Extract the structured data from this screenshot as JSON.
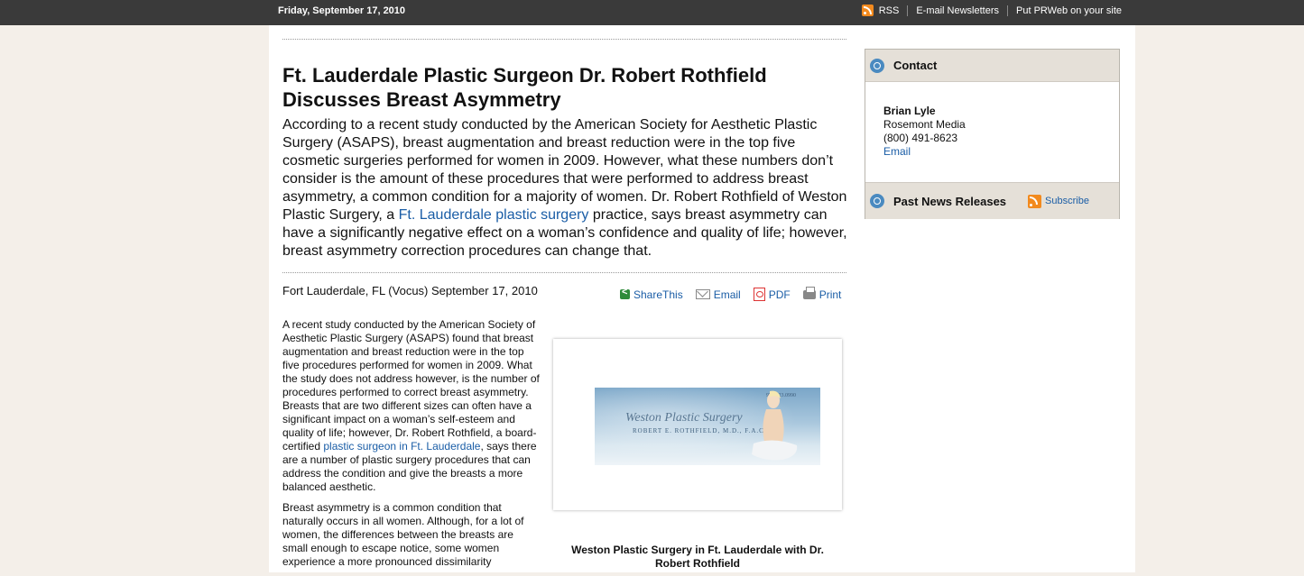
{
  "topbar": {
    "date": "Friday, September 17, 2010",
    "rss": "RSS",
    "newsletters": "E-mail Newsletters",
    "put_prweb": "Put PRWeb on your site"
  },
  "article": {
    "headline": "Ft. Lauderdale Plastic Surgeon Dr. Robert Rothfield Discusses Breast Asymmetry",
    "summary_before": "According to a recent study conducted by the American Society for Aesthetic Plastic Surgery (ASAPS), breast augmentation and breast reduction were in the top five cosmetic surgeries performed for women in 2009. However, what these numbers don’t consider is the amount of these procedures that were performed to address breast asymmetry, a common condition for a majority of women. Dr. Robert Rothfield of Weston Plastic Surgery, a ",
    "summary_link": "Ft. Lauderdale plastic surgery",
    "summary_after": " practice, says breast asymmetry can have a significantly negative effect on a woman’s confidence and quality of life; however, breast asymmetry correction procedures can change that.",
    "dateline": "Fort Lauderdale, FL (Vocus) September 17, 2010",
    "share": {
      "share_this": "ShareThis",
      "email": "Email",
      "pdf": "PDF",
      "print": "Print"
    },
    "para1_before": "A recent study conducted by the American Society of Aesthetic Plastic Surgery (ASAPS) found that breast augmentation and breast reduction were in the top five procedures performed for women in 2009. What the study does not address however, is the number of procedures performed to correct breast asymmetry. Breasts that are two different sizes can often have a significant impact on a woman’s self-esteem and quality of life; however, Dr. Robert Rothfield, a board-certified ",
    "para1_link": "plastic surgeon in Ft. Lauderdale",
    "para1_after": ", says there are a number of plastic surgery procedures that can address the condition and give the breasts a more balanced aesthetic.",
    "para2": "Breast asymmetry is a common condition that naturally occurs in all women. Although, for a lot of women, the differences between the breasts are small enough to escape notice, some women experience a more pronounced dissimilarity",
    "image": {
      "banner_title": "Weston Plastic Surgery",
      "banner_name": "ROBERT E. ROTHFIELD, M.D., F.A.C.S.",
      "banner_phone": "954.423.0990",
      "caption": "Weston Plastic Surgery in Ft. Lauderdale with Dr. Robert Rothfield"
    }
  },
  "sidebar": {
    "contact_title": "Contact",
    "contact_name": "Brian Lyle",
    "contact_org": "Rosemont Media",
    "contact_phone": "(800) 491-8623",
    "contact_email": "Email",
    "past_title": "Past News Releases",
    "subscribe": "Subscribe"
  },
  "colors": {
    "topbar": "#3a3a3a",
    "background": "#f4efe9",
    "link": "#1a5da6",
    "sidebar_header": "#e5e0d8",
    "rss": "#f28a1e"
  }
}
